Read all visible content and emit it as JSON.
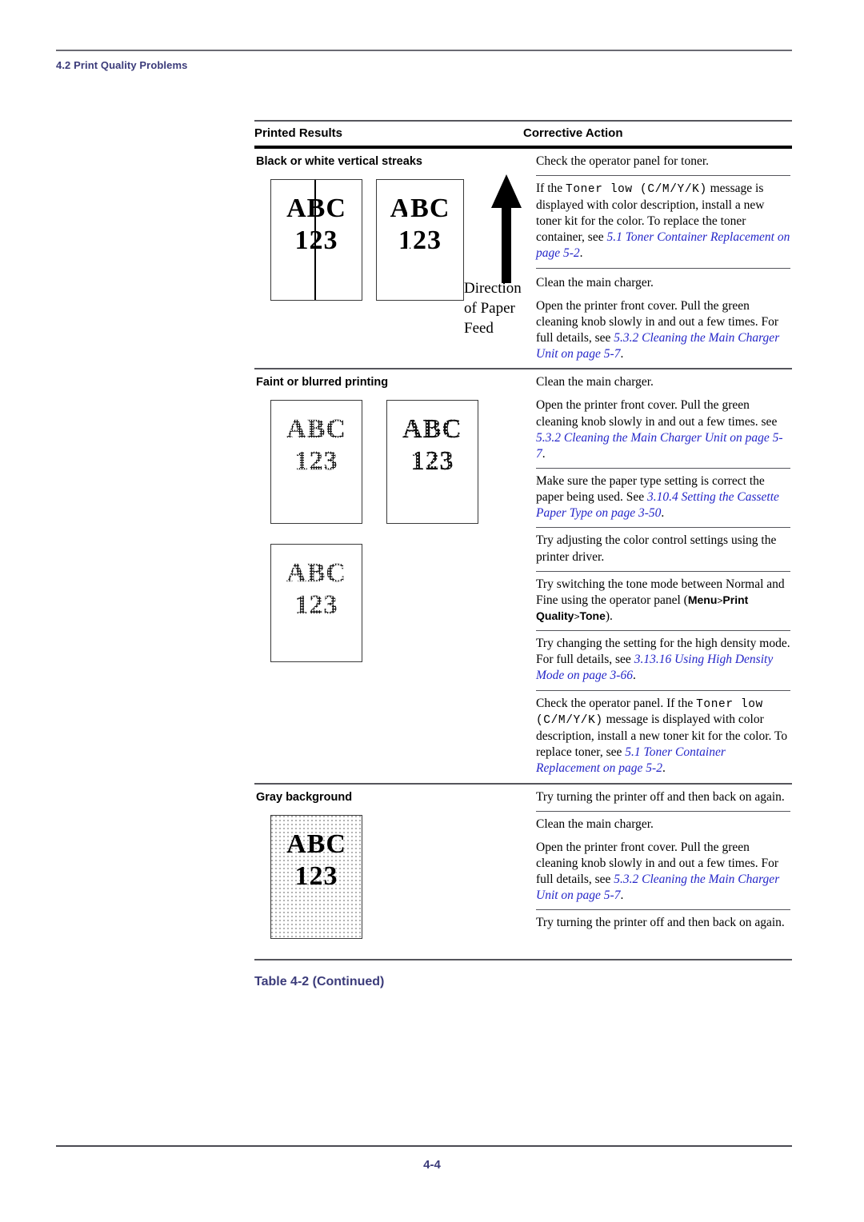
{
  "running_head": "4.2 Print Quality Problems",
  "folio": "4-4",
  "table_caption": "Table 4-2  (Continued)",
  "colors": {
    "heading_blue": "#3b3b7a",
    "xref_blue": "#2426c8",
    "rule_gray": "#55555c"
  },
  "table": {
    "headers": {
      "left": "Printed Results",
      "right": "Corrective Action"
    },
    "sections": [
      {
        "symptom": "Black or white vertical streaks",
        "sample_text": "ABC\n123",
        "feed_label": "Direction\nof Paper\nFeed",
        "feed_label_lines": [
          "Direction",
          "of Paper",
          "Feed"
        ],
        "actions": [
          {
            "parts": [
              {
                "type": "text",
                "value": "Check the operator panel for toner."
              }
            ]
          },
          {
            "parts": [
              {
                "type": "text",
                "value": "If the "
              },
              {
                "type": "mono",
                "value": "Toner low (C/M/Y/K)"
              },
              {
                "type": "text",
                "value": " message is displayed with color description, install a new toner kit for the color. To replace the toner container, see "
              },
              {
                "type": "xref",
                "value": "5.1 Toner Container Replacement on page 5-2"
              },
              {
                "type": "text",
                "value": "."
              }
            ]
          },
          {
            "parts": [
              {
                "type": "text",
                "value": "Clean the main charger."
              }
            ]
          },
          {
            "parts": [
              {
                "type": "text",
                "value": "Open the printer front cover. Pull the green cleaning knob slowly in and out a few times. For full details, see "
              },
              {
                "type": "xref",
                "value": "5.3.2 Cleaning the Main Charger Unit on page 5-7"
              },
              {
                "type": "text",
                "value": "."
              }
            ]
          }
        ]
      },
      {
        "symptom": "Faint or blurred printing",
        "sample_text": "ABC\n123",
        "actions": [
          {
            "parts": [
              {
                "type": "text",
                "value": "Clean the main charger."
              }
            ]
          },
          {
            "parts": [
              {
                "type": "text",
                "value": "Open the printer front cover. Pull the green cleaning knob slowly in and out a few times. For full details, see "
              },
              {
                "type": "xref",
                "value": "5.3.2 Cleaning the Main Charger Unit on page 5-7"
              },
              {
                "type": "text",
                "value": "."
              }
            ]
          },
          {
            "parts": [
              {
                "type": "text",
                "value": "Make sure the paper type setting is correct the paper being used. See "
              },
              {
                "type": "xref",
                "value": "3.10.4 Setting the Cassette Paper Type on page 3-50"
              },
              {
                "type": "text",
                "value": "."
              }
            ]
          },
          {
            "parts": [
              {
                "type": "text",
                "value": "Try adjusting the color control settings using the printer driver."
              }
            ]
          },
          {
            "parts": [
              {
                "type": "text",
                "value": "Try switching the tone mode between Normal and Fine using the operator panel ("
              },
              {
                "type": "ui",
                "value": "Menu"
              },
              {
                "type": "gt",
                "value": ">"
              },
              {
                "type": "ui",
                "value": "Print Quality"
              },
              {
                "type": "gt",
                "value": ">"
              },
              {
                "type": "ui",
                "value": "Tone"
              },
              {
                "type": "text",
                "value": ")."
              }
            ]
          },
          {
            "parts": [
              {
                "type": "text",
                "value": "Try changing the setting for the high density mode. For full details, see "
              },
              {
                "type": "xref",
                "value": "3.13.16 Using High Density Mode on page 3-66"
              },
              {
                "type": "text",
                "value": "."
              }
            ]
          },
          {
            "parts": [
              {
                "type": "text",
                "value": "Check the operator panel. If the "
              },
              {
                "type": "mono",
                "value": "Toner low (C/M/Y/K)"
              },
              {
                "type": "text",
                "value": " message is displayed with color description, install a new toner kit for the color. To replace toner, see "
              },
              {
                "type": "xref",
                "value": "5.1 Toner Container Replacement on page 5-2"
              },
              {
                "type": "text",
                "value": "."
              }
            ]
          }
        ]
      },
      {
        "symptom": "Gray background",
        "sample_text": "ABC\n123",
        "actions": [
          {
            "parts": [
              {
                "type": "text",
                "value": "Try turning the printer off and then back on again."
              }
            ]
          },
          {
            "parts": [
              {
                "type": "text",
                "value": "Clean the main charger."
              }
            ]
          },
          {
            "parts": [
              {
                "type": "text",
                "value": "Open the printer front cover. Pull the green cleaning knob slowly in and out a few times. For full details, see "
              },
              {
                "type": "xref",
                "value": "5.3.2 Cleaning the Main Charger Unit on page 5-7"
              },
              {
                "type": "text",
                "value": "."
              }
            ]
          },
          {
            "parts": [
              {
                "type": "text",
                "value": "Try turning the printer off and then back on again."
              }
            ]
          }
        ]
      }
    ]
  },
  "specimen_lines": {
    "line1": "ABC",
    "line2": "123"
  }
}
